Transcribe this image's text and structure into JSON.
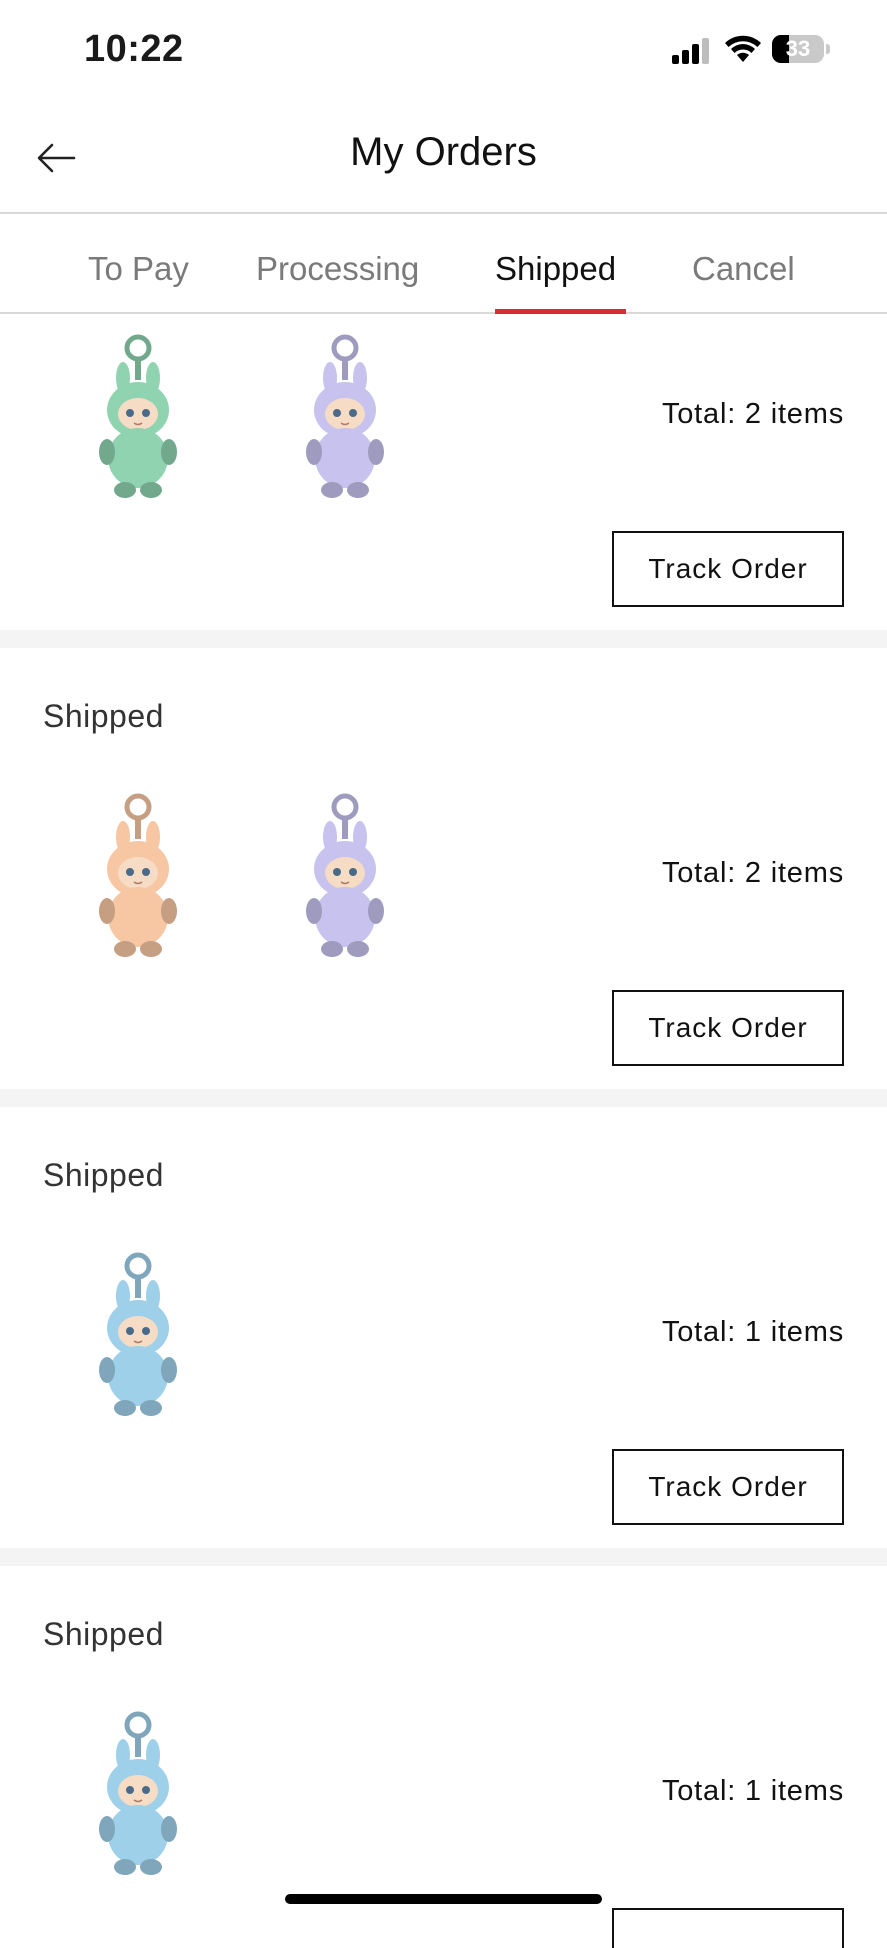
{
  "status_bar": {
    "time": "10:22",
    "battery": "33",
    "battery_level": 0.33
  },
  "header": {
    "title": "My Orders",
    "back_icon": "arrow-left-icon"
  },
  "tabs": [
    {
      "label": "To Pay",
      "active": false
    },
    {
      "label": "Processing",
      "active": false
    },
    {
      "label": "Shipped",
      "active": true
    },
    {
      "label": "Cancel",
      "active": false
    }
  ],
  "accent_color": "#d32f3a",
  "orders": [
    {
      "status": "",
      "total": "Total: 2 items",
      "button": "Track Order",
      "items": [
        {
          "color": "#8fd3b0"
        },
        {
          "color": "#c7c2ee"
        }
      ]
    },
    {
      "status": "Shipped",
      "total": "Total: 2 items",
      "button": "Track Order",
      "items": [
        {
          "color": "#f7c7a3"
        },
        {
          "color": "#c7c2ee"
        }
      ]
    },
    {
      "status": "Shipped",
      "total": "Total: 1 items",
      "button": "Track Order",
      "items": [
        {
          "color": "#9fd0ea"
        }
      ]
    },
    {
      "status": "Shipped",
      "total": "Total: 1 items",
      "button": "",
      "items": [
        {
          "color": "#9fd0ea"
        }
      ]
    }
  ]
}
